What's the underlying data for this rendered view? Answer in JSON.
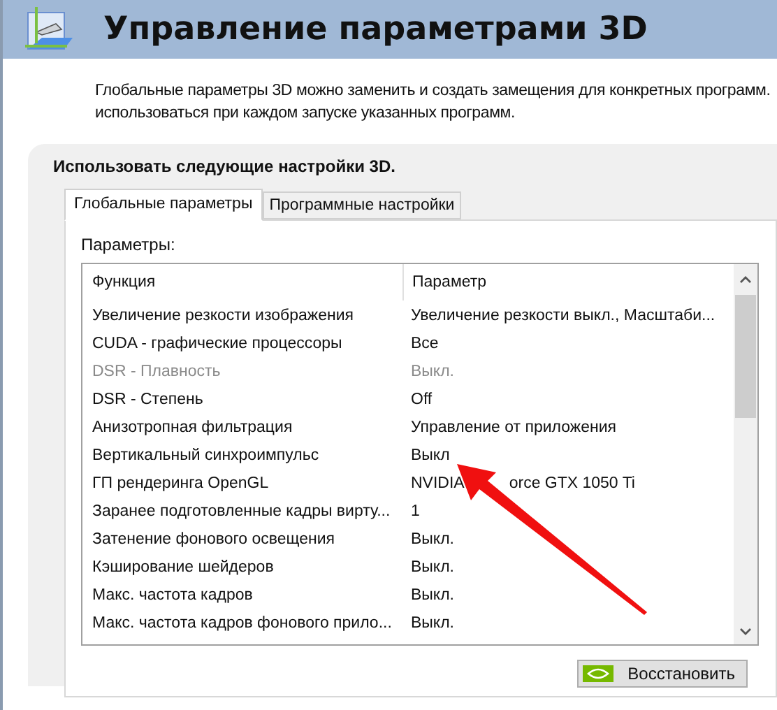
{
  "header": {
    "title": "Управление параметрами 3D"
  },
  "description": [
    "Глобальные параметры 3D можно заменить и создать замещения для конкретных программ.",
    "использоваться при каждом запуске указанных программ."
  ],
  "panel": {
    "heading": "Использовать следующие настройки 3D.",
    "tabs": [
      {
        "label": "Глобальные параметры",
        "selected": true
      },
      {
        "label": "Программные настройки",
        "selected": false
      }
    ],
    "list_label": "Параметры:",
    "columns": [
      "Функция",
      "Параметр"
    ],
    "rows": [
      {
        "function": "Увеличение резкости изображения",
        "value": "Увеличение резкости выкл., Масштаби...",
        "disabled": false
      },
      {
        "function": "CUDA - графические процессоры",
        "value": "Все",
        "disabled": false
      },
      {
        "function": "DSR - Плавность",
        "value": "Выкл.",
        "disabled": true
      },
      {
        "function": "DSR - Степень",
        "value": "Off",
        "disabled": false
      },
      {
        "function": "Анизотропная фильтрация",
        "value": "Управление от приложения",
        "disabled": false
      },
      {
        "function": "Вертикальный синхроимпульс",
        "value": "Выкл",
        "disabled": false
      },
      {
        "function": "ГП рендеринга OpenGL",
        "value_parts": [
          "NVIDIA",
          "orce GTX 1050 Ti"
        ],
        "disabled": false
      },
      {
        "function": "Заранее подготовленные кадры вирту...",
        "value": "1",
        "disabled": false
      },
      {
        "function": "Затенение фонового освещения",
        "value": "Выкл.",
        "disabled": false
      },
      {
        "function": "Кэширование шейдеров",
        "value": "Выкл.",
        "disabled": false
      },
      {
        "function": "Макс. частота кадров",
        "value": "Выкл.",
        "disabled": false
      },
      {
        "function": "Макс. частота кадров фонового прило...",
        "value": "Выкл.",
        "disabled": false
      }
    ],
    "restore_button": "Восстановить"
  }
}
